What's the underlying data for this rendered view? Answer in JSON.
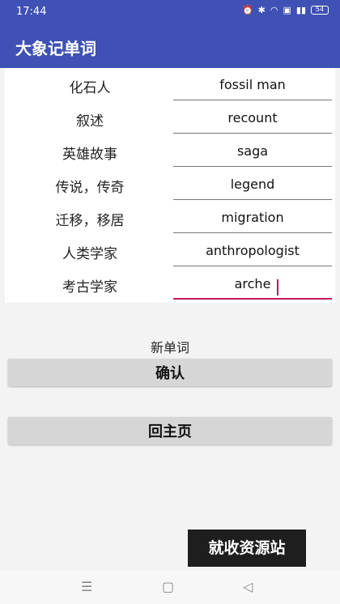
{
  "status": {
    "time": "17:44",
    "battery": "54"
  },
  "app": {
    "title": "大象记单词"
  },
  "words": [
    {
      "zh": "化石人",
      "en": "fossil man"
    },
    {
      "zh": "叙述",
      "en": "recount"
    },
    {
      "zh": "英雄故事",
      "en": "saga"
    },
    {
      "zh": "传说，传奇",
      "en": "legend"
    },
    {
      "zh": "迁移，移居",
      "en": "migration"
    },
    {
      "zh": "人类学家",
      "en": "anthropologist"
    },
    {
      "zh": "考古学家",
      "en": "arche"
    }
  ],
  "new_word_label": "新单词",
  "buttons": {
    "confirm": "确认",
    "home": "回主页"
  },
  "watermark": "就收资源站",
  "colors": {
    "accent": "#3f51b5",
    "focus": "#c2185b"
  },
  "icons": [
    "alarm-icon",
    "bluetooth-icon",
    "wifi-icon",
    "hd-icon",
    "signal-icon",
    "battery-icon",
    "menu-icon",
    "home-icon",
    "back-icon"
  ]
}
